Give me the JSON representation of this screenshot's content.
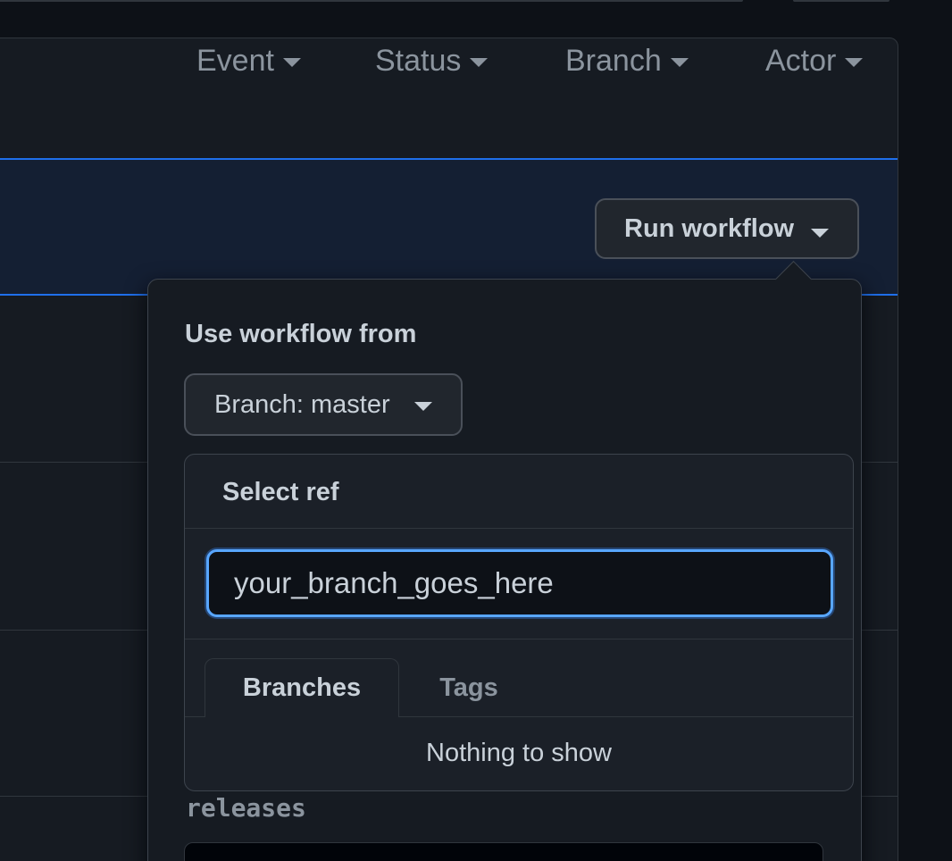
{
  "filters": [
    {
      "label": "Event"
    },
    {
      "label": "Status"
    },
    {
      "label": "Branch"
    },
    {
      "label": "Actor"
    }
  ],
  "dispatch": {
    "run_button_label": "Run workflow"
  },
  "popover": {
    "heading": "Use workflow from",
    "branch_button_label": "Branch: master",
    "ref_menu": {
      "title": "Select ref",
      "input_value": "your_branch_goes_here",
      "tabs": [
        {
          "label": "Branches",
          "selected": true
        },
        {
          "label": "Tags",
          "selected": false
        }
      ],
      "empty_message": "Nothing to show"
    },
    "input_label": "releases"
  },
  "colors": {
    "background": "#0d1117",
    "panel": "#161b22",
    "accent_blue": "#1f6feb",
    "focus_blue": "#58a6ff",
    "border": "#30363d"
  }
}
